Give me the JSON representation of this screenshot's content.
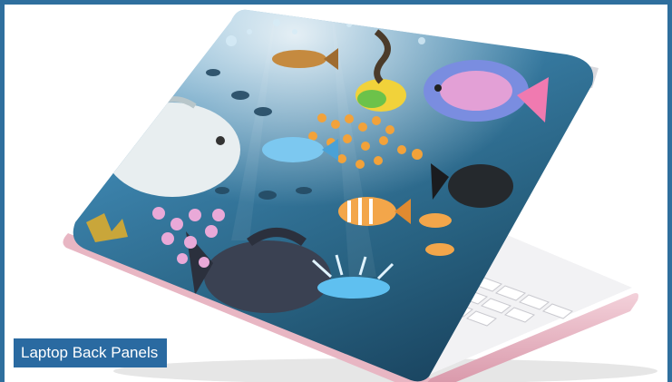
{
  "caption": {
    "text": "Laptop Back Panels"
  },
  "colors": {
    "frame_border": "#2f6f9e",
    "caption_background": "#2a6aa1",
    "caption_text": "#ffffff",
    "skin_background": "#2b6a8e",
    "laptop_body": "#e9b7c4"
  },
  "image": {
    "subject": "laptop-with-underwater-fish-skin"
  }
}
